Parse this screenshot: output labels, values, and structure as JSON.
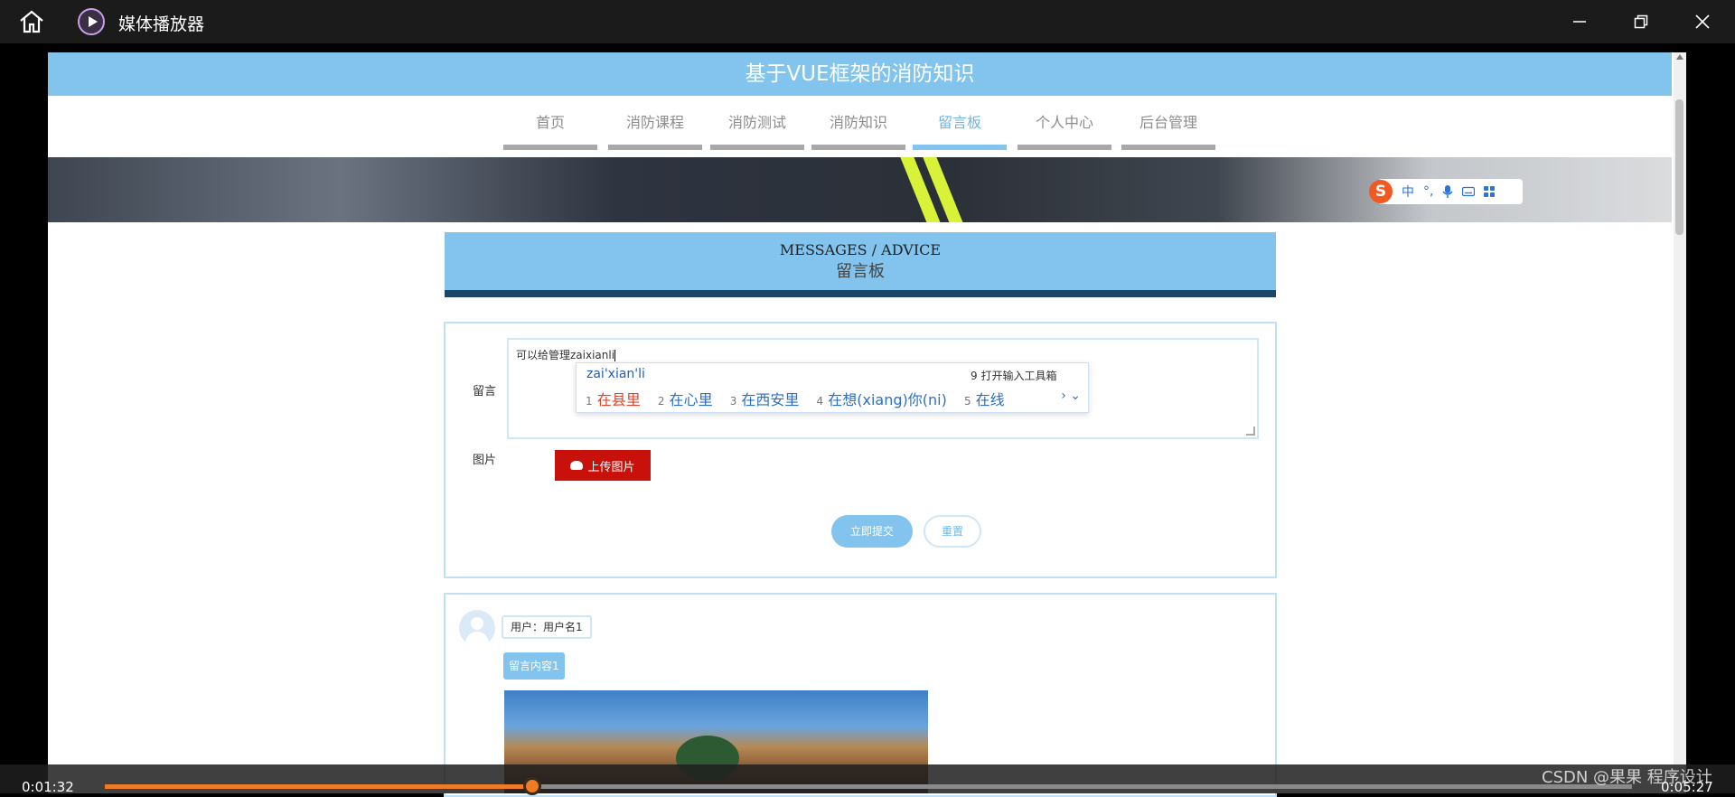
{
  "window": {
    "title": "媒体播放器"
  },
  "site": {
    "title": "基于VUE框架的消防知识",
    "nav": [
      {
        "label": "首页",
        "active": false
      },
      {
        "label": "消防课程",
        "active": false
      },
      {
        "label": "消防测试",
        "active": false
      },
      {
        "label": "消防知识",
        "active": false
      },
      {
        "label": "留言板",
        "active": true
      },
      {
        "label": "个人中心",
        "active": false
      },
      {
        "label": "后台管理",
        "active": false
      }
    ]
  },
  "ime_toolbar": {
    "logo": "S",
    "mode": "中",
    "punct": "°,"
  },
  "section": {
    "title_en": "MESSAGES / ADVICE",
    "title_cn": "留言板"
  },
  "form": {
    "message_label": "留言",
    "message_value": "可以给管理zaixianli",
    "image_label": "图片",
    "upload_label": "上传图片",
    "submit_label": "立即提交",
    "reset_label": "重置"
  },
  "ime_popup": {
    "pinyin": "zai'xian'li",
    "tool": "9 打开输入工具箱",
    "candidates": [
      {
        "num": "1",
        "text": "在县里"
      },
      {
        "num": "2",
        "text": "在心里"
      },
      {
        "num": "3",
        "text": "在西安里"
      },
      {
        "num": "4",
        "text": "在想(xiang)你(ni)"
      },
      {
        "num": "5",
        "text": "在线"
      }
    ]
  },
  "comment": {
    "user": "用户：用户名1",
    "content": "留言内容1"
  },
  "player": {
    "elapsed": "0:01:32",
    "total": "0:05:27",
    "progress": 0.28
  },
  "watermark": "CSDN @果果 程序设计",
  "colors": {
    "accent": "#82c4ed",
    "progress": "#f07b25",
    "upload": "#c8110b"
  }
}
